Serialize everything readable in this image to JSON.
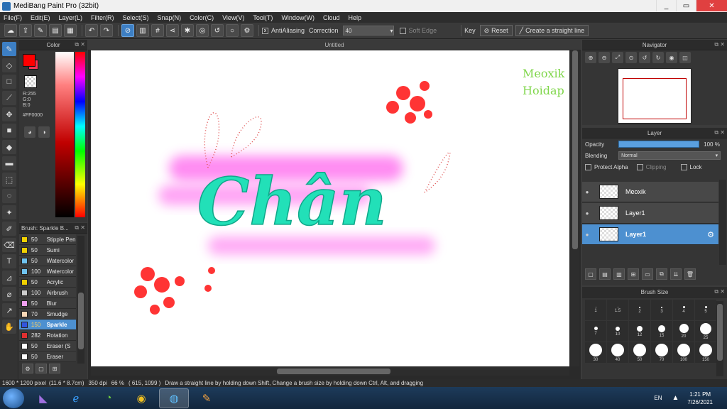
{
  "window": {
    "title": "MediBang Paint Pro (32bit)",
    "controls": {
      "minimize": "_",
      "maximize": "▭",
      "close": "✕"
    }
  },
  "menubar": [
    "File(F)",
    "Edit(E)",
    "Layer(L)",
    "Filter(R)",
    "Select(S)",
    "Snap(N)",
    "Color(C)",
    "View(V)",
    "Tool(T)",
    "Window(W)",
    "Cloud",
    "Help"
  ],
  "toolbar": {
    "antialias_label": "AntiAliasing",
    "antialias_checked": "x",
    "correction_label": "Correction",
    "correction_value": "40",
    "soft_edge_label": "Soft Edge",
    "key_label": "Key",
    "reset_label": "Reset",
    "straight_line_label": "Create a straight line"
  },
  "color_panel": {
    "title": "Color",
    "foreground": "#ff0000",
    "rgb": "R:255\nG:0\nB:0",
    "hex": "#FF0000"
  },
  "brush_panel": {
    "title": "Brush: Sparkle B...",
    "items": [
      {
        "size": "50",
        "name": "Stipple Pen",
        "color": "#f0d000"
      },
      {
        "size": "50",
        "name": "Sumi",
        "color": "#f0d000"
      },
      {
        "size": "50",
        "name": "Watercolor",
        "color": "#6fc3f0"
      },
      {
        "size": "100",
        "name": "Watercolor",
        "color": "#6fc3f0"
      },
      {
        "size": "50",
        "name": "Acrylic",
        "color": "#f0d000"
      },
      {
        "size": "100",
        "name": "Airbrush",
        "color": "#cccccc"
      },
      {
        "size": "50",
        "name": "Blur",
        "color": "#f0a0f0"
      },
      {
        "size": "70",
        "name": "Smudge",
        "color": "#f8d8b8"
      },
      {
        "size": "150",
        "name": "Sparkle",
        "color": "#3355dd"
      },
      {
        "size": "282",
        "name": "Rotation",
        "color": "#e03030"
      },
      {
        "size": "50",
        "name": "Eraser (S",
        "color": "#ffffff"
      },
      {
        "size": "50",
        "name": "Eraser",
        "color": "#ffffff"
      }
    ],
    "selected_index": 8
  },
  "document": {
    "tab": "Untitled",
    "watermark_line1": "Meoxik",
    "watermark_line2": "Hoidap",
    "lettering": "Chân"
  },
  "navigator": {
    "title": "Navigator"
  },
  "layer_panel": {
    "title": "Layer",
    "opacity_label": "Opacity",
    "opacity_value": "100 %",
    "opacity_fraction": 1.0,
    "blending_label": "Blending",
    "blending_value": "Normal",
    "protect_alpha": "Protect Alpha",
    "clipping": "Clipping",
    "lock": "Lock",
    "layers": [
      {
        "name": "Meoxik",
        "selected": false
      },
      {
        "name": "Layer1",
        "selected": false
      },
      {
        "name": "Layer1",
        "selected": true
      }
    ]
  },
  "brush_size_panel": {
    "title": "Brush Size",
    "sizes": [
      "1",
      "1.5",
      "2",
      "3",
      "4",
      "5",
      "7",
      "10",
      "12",
      "15",
      "20",
      "25",
      "30",
      "40",
      "50",
      "70",
      "100",
      "150"
    ]
  },
  "statusbar": {
    "dimensions": "1600 * 1200 pixel",
    "physical": "(11.6 * 8.7cm)",
    "dpi": "350 dpi",
    "zoom": "66 %",
    "coords": "( 615, 1099 )",
    "hint": "Draw a straight line by holding down Shift, Change a brush size by holding down Ctrl, Alt, and dragging"
  },
  "taskbar": {
    "language": "EN",
    "time": "1:21 PM",
    "date": "7/26/2021"
  },
  "colors": {
    "accent": "#4d90d0",
    "lettering": "#22e0b8",
    "glow": "#ff66ee",
    "sparkle": "#ff1010",
    "watermark": "#7fd64a"
  }
}
